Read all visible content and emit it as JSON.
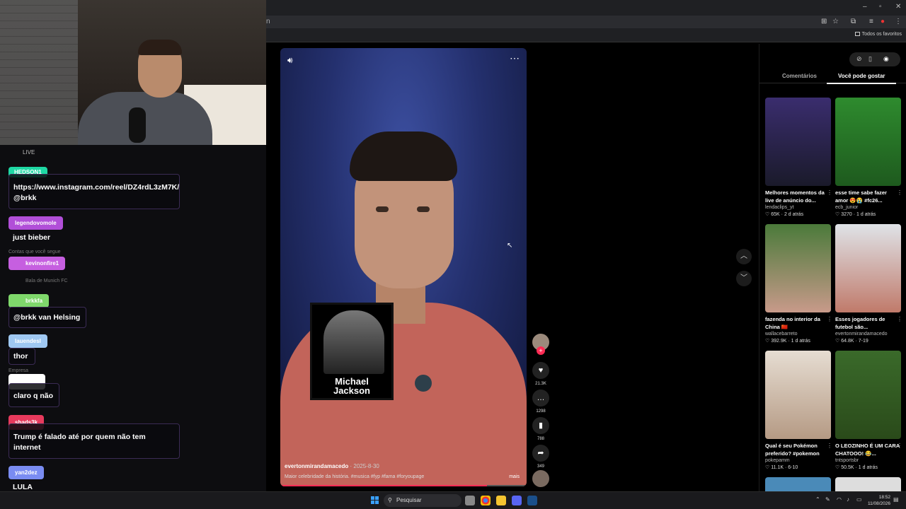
{
  "browser": {
    "bookmarks_label": "Todos os favoritos"
  },
  "chat": {
    "live_label": "LIVE",
    "ghost_lines": [
      "Contas que você segue",
      "Bala de Munich FC",
      "Empresa"
    ],
    "messages": [
      {
        "user": "HEDSON1",
        "text": "https://www.instagram.com/reel/DZ4rdL3zM7K/ @brkk",
        "color": "#1fd8a4"
      },
      {
        "user": "legendovomole",
        "text": "just bieber",
        "color": "#b14fd8"
      },
      {
        "user": "kevinonfire1",
        "text": "",
        "color": "#c65fe0"
      },
      {
        "user": "brkkfa",
        "text": "@brkk van Helsing",
        "color": "#7fd86b"
      },
      {
        "user": "lauendesl",
        "text": "thor",
        "color": "#9fc8f2"
      },
      {
        "user": "",
        "text": "claro q não",
        "color": "#ffffff"
      },
      {
        "user": "shads3k",
        "text": "Trump é falado até por quem não tem internet",
        "color": "#e83a5d"
      },
      {
        "user": "yan2dez",
        "text": "LULA",
        "color": "#7a8cf2"
      }
    ]
  },
  "video": {
    "photo_caption_line1": "Michael",
    "photo_caption_line2": "Jackson",
    "author": "evertonmirandamacedo",
    "date": "· 2025-8-30",
    "description": "Maior celebridade da história. #musica #fyp #fama #foryoupage",
    "more_label": "mais",
    "progress": 0.84
  },
  "actions": {
    "likes": "21.3K",
    "comments": "1298",
    "saves": "788",
    "shares": "349"
  },
  "side_panel": {
    "tabs": [
      "Comentários",
      "Você pode gostar"
    ],
    "active_tab": "Você pode gostar",
    "cards": [
      {
        "title": "Melhores momentos da live de anúncio do...",
        "creator": "lendaclips_yt",
        "likes": "65K",
        "age": "2 d atrás",
        "c1": "#3a2d6e",
        "c2": "#1a1a2a"
      },
      {
        "title": "esse time sabe fazer amor 😍😭 #fc26...",
        "creator": "ecb_junior",
        "likes": "3270",
        "age": "1 d atrás",
        "c1": "#2e8b2e",
        "c2": "#1e5a1e"
      },
      {
        "title": "fazenda no interior da China 🇨🇳",
        "creator": "wallacebarreto",
        "likes": "392.9K",
        "age": "1 d atrás",
        "c1": "#4a7a3a",
        "c2": "#c89a8a"
      },
      {
        "title": "Esses jogadores de futebol são...",
        "creator": "evertonmirandamacedo",
        "likes": "64.8K",
        "age": "7-19",
        "c1": "#dfe3e8",
        "c2": "#c07a6a"
      },
      {
        "title": "Qual é seu Pokémon preferido? #pokemon",
        "creator": "pokepamm",
        "likes": "11.1K",
        "age": "6-10",
        "c1": "#e6ddd2",
        "c2": "#b59a84"
      },
      {
        "title": "O LEOZINHO É UM CARA CHATOOO! 😂...",
        "creator": "tntsportsbr",
        "likes": "50.5K",
        "age": "1 d atrás",
        "c1": "#3a6a2a",
        "c2": "#2a4a1a"
      }
    ]
  },
  "taskbar": {
    "search_placeholder": "Pesquisar",
    "time": "18:52",
    "date": "11/08/2026"
  }
}
